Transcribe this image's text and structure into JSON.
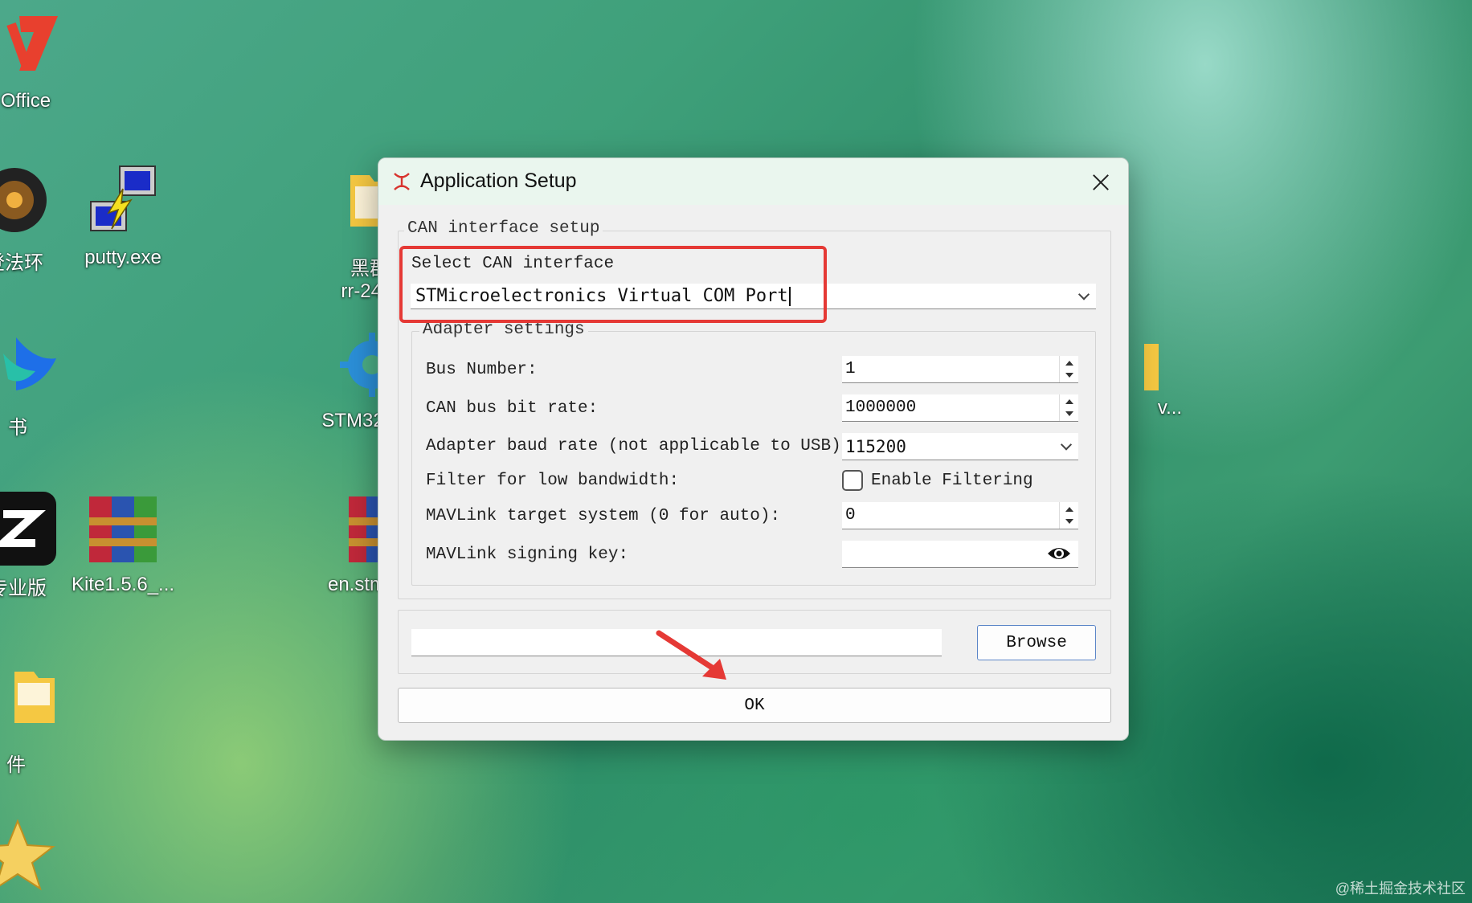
{
  "desktop": {
    "icons": [
      {
        "label": "Office"
      },
      {
        "label": "登法环"
      },
      {
        "label": "putty.exe"
      },
      {
        "label": "黑群"
      },
      {
        "label": "rr-24."
      },
      {
        "label": "书"
      },
      {
        "label": "STM32"
      },
      {
        "label": "v..."
      },
      {
        "label": "专业版"
      },
      {
        "label": "Kite1.5.6_..."
      },
      {
        "label": "en.stm"
      },
      {
        "label": "件"
      }
    ],
    "watermark": "@稀土掘金技术社区"
  },
  "dialog": {
    "title": "Application Setup",
    "can_group_title": "CAN interface setup",
    "select_label": "Select CAN interface",
    "select_value": "STMicroelectronics Virtual COM Port",
    "adapter_group_title": "Adapter settings",
    "rows": [
      {
        "label": "Bus Number:",
        "value": "1"
      },
      {
        "label": "CAN bus bit rate:",
        "value": "1000000"
      },
      {
        "label": "Adapter baud rate (not applicable to USB):",
        "value": "115200"
      },
      {
        "label": "Filter for low bandwidth:",
        "value": "Enable Filtering"
      },
      {
        "label": "MAVLink target system (0 for auto):",
        "value": "0"
      },
      {
        "label": "MAVLink signing key:",
        "value": ""
      }
    ],
    "browse_label": "Browse",
    "ok_label": "OK"
  },
  "colors": {
    "highlight_box": "#e53935",
    "arrow": "#e53935"
  }
}
